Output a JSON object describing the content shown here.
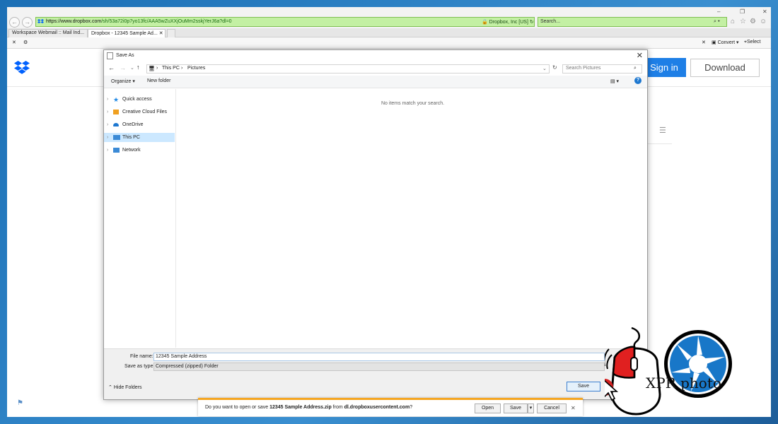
{
  "browser": {
    "url_host": "https://www.dropbox.com",
    "url_rest": "/sh/53a72i0p7yo13fc/AAA5wZuXXjOuMm2sskjYerJ6a?dl=0",
    "cert_label": "Dropbox, Inc [US]",
    "search_placeholder": "Search...",
    "tabs": [
      {
        "label": "Workspace Webmail :: Mail Ind..."
      },
      {
        "label": "Dropbox - 12345 Sample Ad..."
      }
    ],
    "commands": {
      "convert": "Convert",
      "select": "Select"
    }
  },
  "page": {
    "signin_label": "Sign in",
    "download_label": "Download"
  },
  "dialog": {
    "title": "Save As",
    "path": [
      "This PC",
      "Pictures"
    ],
    "search_placeholder": "Search Pictures",
    "toolbar": {
      "organize": "Organize",
      "new_folder": "New folder"
    },
    "nav_items": [
      {
        "label": "Quick access",
        "icon": "star-icon",
        "color": "#1e88e5"
      },
      {
        "label": "Creative Cloud Files",
        "icon": "creative-cloud-icon",
        "color": "#f0a020"
      },
      {
        "label": "OneDrive",
        "icon": "onedrive-icon",
        "color": "#1e78d0"
      },
      {
        "label": "This PC",
        "icon": "computer-icon",
        "color": "#3b8ad6"
      },
      {
        "label": "Network",
        "icon": "network-icon",
        "color": "#3b8ad6"
      }
    ],
    "empty_message": "No items match your search.",
    "file_name_label": "File name:",
    "file_name_value": "12345 Sample Address",
    "save_as_type_label": "Save as type:",
    "save_as_type_value": "Compressed (zipped) Folder",
    "hide_folders_label": "Hide Folders",
    "save_label": "Save"
  },
  "download_bar": {
    "prefix": "Do you want to open or save ",
    "filename": "12345 Sample Address.zip",
    "middle": " from ",
    "host": "dl.dropboxusercontent.com",
    "suffix": "?",
    "open_label": "Open",
    "save_label": "Save",
    "cancel_label": "Cancel"
  },
  "watermark": {
    "brand": "XPR photo"
  }
}
